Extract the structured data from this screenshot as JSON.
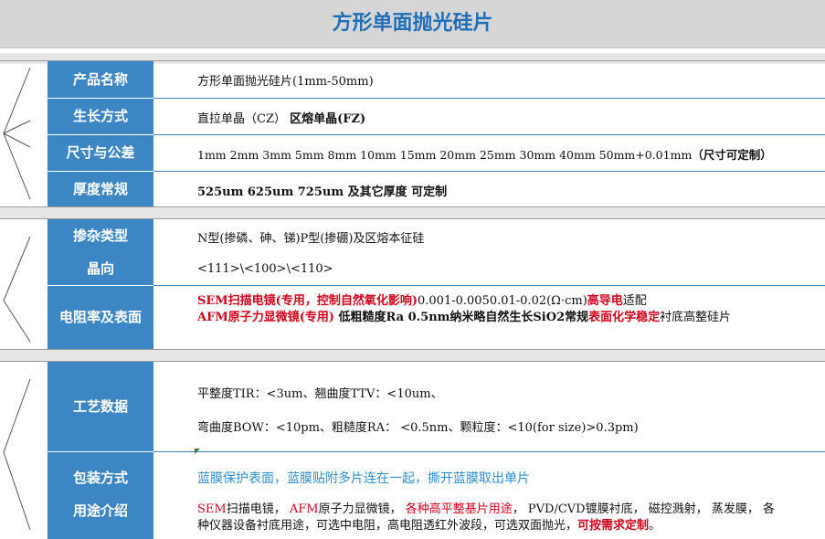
{
  "title": "方形单面抛光硅片",
  "section1": {
    "rows": [
      {
        "label": "产品名称",
        "value": "方形单面抛光硅片(1mm-50mm)"
      },
      {
        "label": "生长方式",
        "value_a": "直拉单晶（CZ）",
        "value_b": "区熔单晶(FZ)"
      },
      {
        "label": "尺寸与公差",
        "value_a": "1mm 2mm 3mm 5mm 8mm 10mm 15mm 20mm 25mm 30mm 40mm 50mm+0.01mm",
        "value_b": "（尺寸可定制）"
      },
      {
        "label": "厚度常规",
        "value_a": "525um 625um 725um 及其它厚度",
        "value_b": "可定制"
      }
    ]
  },
  "section2": {
    "rows": [
      {
        "label": "掺杂类型",
        "value": "N型(掺磷、砷、锑)P型(掺硼)及区熔本征硅"
      },
      {
        "label": "晶向",
        "value": "<111>\\<100>\\<110>"
      },
      {
        "label": "电阻率及表面",
        "p1_red": "SEM扫描电镜(专用，控制自然氧化影响)",
        "p1_plain": "0.001-0.0050.01-0.02(Ω·cm)",
        "p1_red2": "高导电",
        "p1_tail": "适配",
        "p2_red": "AFM原子力显微镜(专用)",
        "p2_plain": " 低粗糙度Ra 0.5nm纳米略自然生长SiO2常规",
        "p2_red2": "表面化学稳定",
        "p2_tail": "衬底高整硅片"
      }
    ]
  },
  "section3": {
    "rows": [
      {
        "label": "工艺数据",
        "line1": "平整度TIR：<3um、翘曲度TTV：<10um、",
        "line2": "弯曲度BOW：<10pm、粗糙度RA： <0.5nm、颗粒度：<10(for size)>0.3pm)"
      },
      {
        "label": "包装方式",
        "value": "蓝膜保护表面，蓝膜贴附多片连在一起，撕开蓝膜取出单片"
      },
      {
        "label": "用途介绍",
        "r1": "SEM",
        "t1": "扫描电镜，",
        "r2": "AFM",
        "t2": "原子力显微镜，",
        "r3": "各种高平整基片用途",
        "t3": "， PVD/CVD镀膜衬底， 磁控溅射， 蒸发膜， 各种仪器设备衬底用途，可选中电阻，高电阻透红外波段，可选双面抛光，",
        "r4": "可按需求定制",
        "t4": "。"
      }
    ]
  },
  "colors": {
    "label_bg": "#3d86c4",
    "title": "#1f6fb8",
    "accent_red": "#d0021b",
    "pack_blue": "#2f8fd0"
  }
}
